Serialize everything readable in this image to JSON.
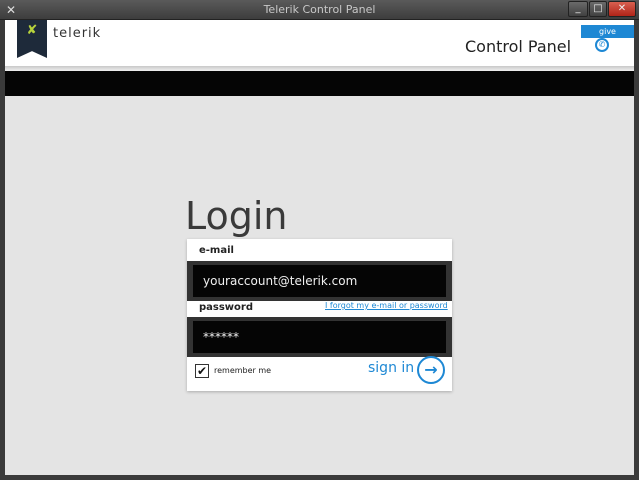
{
  "window": {
    "title": "Telerik Control Panel"
  },
  "header": {
    "brand": "telerik",
    "feedback": "give feedback",
    "title": "Control Panel"
  },
  "login": {
    "title": "Login",
    "email_label": "e-mail",
    "email_value": "youraccount@telerik.com",
    "password_label": "password",
    "forgot_link": "I forgot my e-mail or password",
    "password_value": "******",
    "remember_label": "remember me",
    "sign_in_label": "sign in"
  },
  "icons": {
    "app": "telerik-icon",
    "support": "phone-icon",
    "next": "arrow-right-icon"
  },
  "colors": {
    "accent": "#1e88d4",
    "logo_bg": "#1e2a3a",
    "logo_mark": "#b7d23c"
  }
}
